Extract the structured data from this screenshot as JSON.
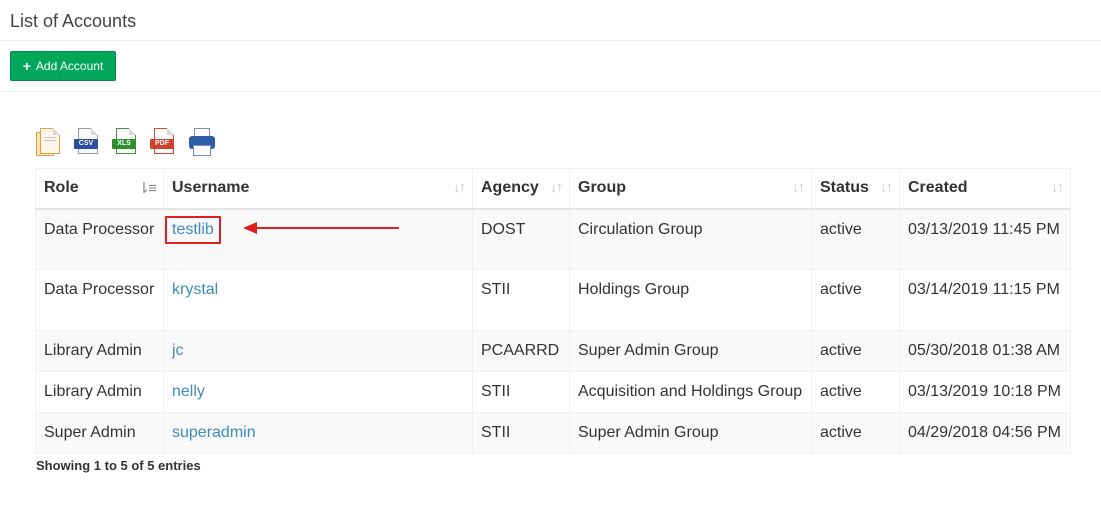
{
  "page": {
    "title": "List of Accounts"
  },
  "toolbar": {
    "add_label": "Add Account",
    "add_icon": "plus-icon"
  },
  "exports": [
    {
      "name": "copy",
      "icon": "copy-icon",
      "tag": ""
    },
    {
      "name": "csv",
      "icon": "csv-icon",
      "tag": "CSV"
    },
    {
      "name": "excel",
      "icon": "xls-icon",
      "tag": "XLS"
    },
    {
      "name": "pdf",
      "icon": "pdf-icon",
      "tag": "PDF"
    },
    {
      "name": "print",
      "icon": "print-icon",
      "tag": ""
    }
  ],
  "table": {
    "columns": [
      "Role",
      "Username",
      "Agency",
      "Group",
      "Status",
      "Created"
    ],
    "rows": [
      {
        "role": "Data Processor",
        "username": "testlib",
        "agency": "DOST",
        "group": "Circulation Group",
        "status": "active",
        "created": "03/13/2019 11:45 PM"
      },
      {
        "role": "Data Processor",
        "username": "krystal",
        "agency": "STII",
        "group": "Holdings Group",
        "status": "active",
        "created": "03/14/2019 11:15 PM"
      },
      {
        "role": "Library Admin",
        "username": "jc",
        "agency": "PCAARRD",
        "group": "Super Admin Group",
        "status": "active",
        "created": "05/30/2018 01:38 AM"
      },
      {
        "role": "Library Admin",
        "username": "nelly",
        "agency": "STII",
        "group": "Acquisition and Holdings Group",
        "status": "active",
        "created": "03/13/2019 10:18 PM"
      },
      {
        "role": "Super Admin",
        "username": "superadmin",
        "agency": "STII",
        "group": "Super Admin Group",
        "status": "active",
        "created": "04/29/2018 04:56 PM"
      }
    ]
  },
  "footer": {
    "info": "Showing 1 to 5 of 5 entries"
  },
  "colors": {
    "add_button": "#00a65a",
    "link": "#3c8dbc",
    "highlight": "#e02020"
  }
}
